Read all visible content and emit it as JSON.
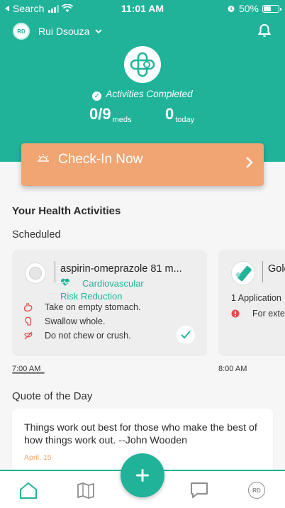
{
  "status_bar": {
    "carrier": "Search",
    "time": "11:01 AM",
    "battery": "50%",
    "battery_level": 0.5,
    "icons": [
      "back-arrow-icon",
      "signal-icon",
      "wifi-icon",
      "alarm-icon",
      "battery-icon"
    ]
  },
  "header": {
    "avatar_initials": "RD",
    "user_name": "Rui Dsouza",
    "activities_label": "Activities Completed",
    "meds_value": "0/9",
    "meds_unit": "meds",
    "today_value": "0",
    "today_unit": "today"
  },
  "checkin": {
    "label": "Check-In Now"
  },
  "health": {
    "section_title": "Your Health Activities",
    "scheduled_title": "Scheduled",
    "cards": [
      {
        "name": "aspirin-omeprazole 81 m...",
        "category_line1": "Cardiovascular",
        "category_line2": "Risk Reduction",
        "instructions": [
          "Take on empty stomach.",
          "Swallow whole.",
          "Do not chew or crush."
        ],
        "time": "7:00 AM",
        "completed": true
      },
      {
        "name": "Gold",
        "dose": "1 Application",
        "instruction": "For exte",
        "time": "8:00 AM"
      }
    ]
  },
  "quote": {
    "title": "Quote of the Day",
    "text": "Things work out best for those who make the best of how things work out. --John Wooden",
    "date": "April, 15"
  },
  "tabbar": {
    "avatar_initials": "RD"
  },
  "colors": {
    "primary": "#20b39a",
    "accent": "#f0a573",
    "background": "#f6f6f6"
  }
}
